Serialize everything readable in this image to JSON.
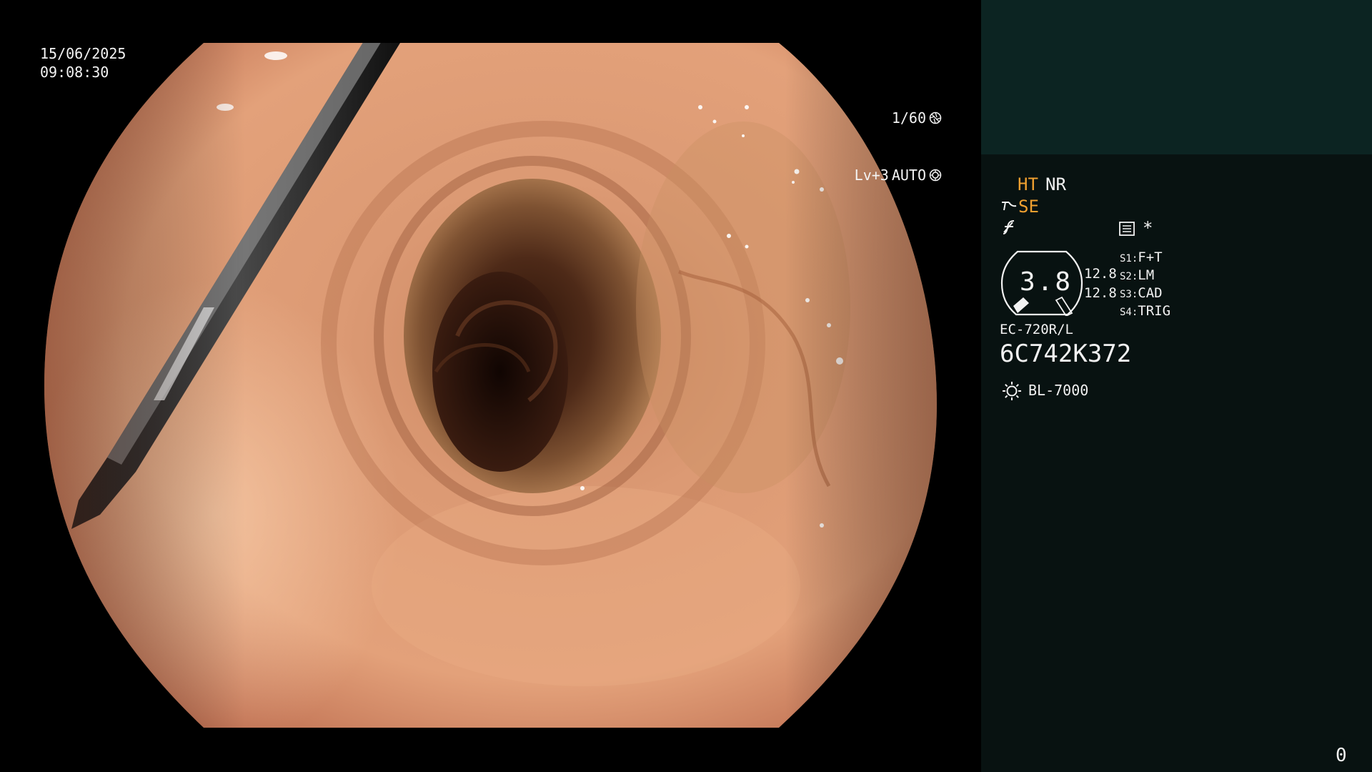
{
  "overlay": {
    "date": "15/06/2025",
    "time": "09:08:30",
    "shutter": "1/60",
    "iris_level": "Lv+3",
    "iris_mode": "AUTO"
  },
  "panel": {
    "mode_ht": "HT",
    "mode_nr": "NR",
    "mode_se": "SE",
    "asterisk": "*",
    "gauge_value": "3.8",
    "gain_1": "12.8",
    "gain_2": "12.8",
    "switches": [
      {
        "key": "S1:",
        "value": "F+T"
      },
      {
        "key": "S2:",
        "value": "LM"
      },
      {
        "key": "S3:",
        "value": "CAD"
      },
      {
        "key": "S4:",
        "value": "TRIG"
      }
    ],
    "scope_model": "EC-720R/L",
    "scope_serial": "6C742K372",
    "light_source": "BL-7000",
    "counter": "0"
  },
  "icons": {
    "shutter": "aperture-icon",
    "iris": "iris-icon",
    "se": "structure-enhance-icon",
    "f": "freeze-icon",
    "menu": "menu-list-icon",
    "light": "sun-icon"
  },
  "colors": {
    "accent": "#f0a030",
    "panel_bg": "#081211",
    "thumb_bg": "#0c2422"
  }
}
